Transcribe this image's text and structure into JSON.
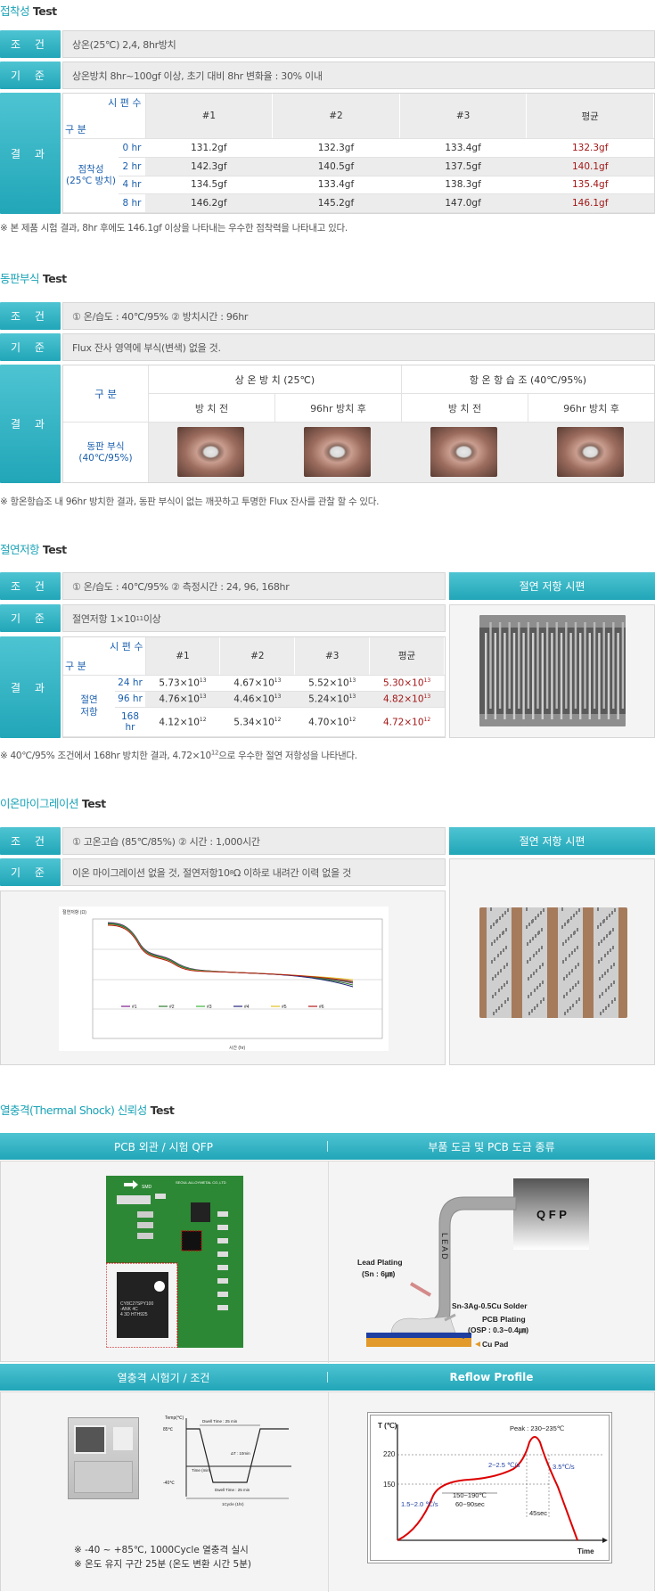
{
  "s1": {
    "title_k": "접착성",
    "title_t": " Test",
    "cond_label": "조 건",
    "cond_value": "상온(25℃) 2,4, 8hr방치",
    "std_label": "기 준",
    "std_value": "상온방치 8hr~100gf 이상, 초기 대비 8hr 변화율 : 30% 이내",
    "res_label": "결 과",
    "hdr_gubun": "구 분",
    "hdr_sample": "시 편 수",
    "hdr_cols": [
      "#1",
      "#2",
      "#3",
      "평균"
    ],
    "row_group": "점착성\n(25℃ 방치)",
    "rows": [
      {
        "t": "0 hr",
        "v": [
          "131.2gf",
          "132.3gf",
          "133.4gf",
          "132.3gf"
        ]
      },
      {
        "t": "2 hr",
        "v": [
          "142.3gf",
          "140.5gf",
          "137.5gf",
          "140.1gf"
        ]
      },
      {
        "t": "4 hr",
        "v": [
          "134.5gf",
          "133.4gf",
          "138.3gf",
          "135.4gf"
        ]
      },
      {
        "t": "8 hr",
        "v": [
          "146.2gf",
          "145.2gf",
          "147.0gf",
          "146.1gf"
        ]
      }
    ],
    "note": "※ 본 제품 시험 결과, 8hr 후에도 146.1gf 이상을 나타내는 우수한 점착력을 나타내고 있다."
  },
  "s2": {
    "title_k": "동판부식",
    "title_t": " Test",
    "cond_label": "조 건",
    "cond_value": "① 온/습도 : 40℃/95%     ② 방치시간 : 96hr",
    "std_label": "기 준",
    "std_value": "Flux 잔사 영역에 부식(변색) 없을 것.",
    "res_label": "결 과",
    "gubun": "구 분",
    "grp1": "상 온 방 치 (25℃)",
    "grp2": "항 온 항 습 조 (40℃/95%)",
    "sub": [
      "방 치 전",
      "96hr 방치 후",
      "방 치 전",
      "96hr 방치 후"
    ],
    "row_label": "동판 부식\n(40℃/95%)",
    "note": "※ 항온항습조 내 96hr 방치한 결과, 동판 부식이 없는 깨끗하고 투명한 Flux 잔사를 관찰 할 수 있다."
  },
  "s3": {
    "title_k": "절연저항",
    "title_t": " Test",
    "cond_label": "조 건",
    "cond_value": "① 온/습도 : 40℃/95%     ② 측정시간 :  24, 96, 168hr",
    "std_label": "기 준",
    "std_value_a": "절연저항 1×10",
    "std_value_sup": "11",
    "std_value_b": " 이상",
    "res_label": "결 과",
    "side_title": "절연 저항 시편",
    "hdr_gubun": "구 분",
    "hdr_sample": "시 편 수",
    "hdr_cols": [
      "#1",
      "#2",
      "#3",
      "평균"
    ],
    "row_group": "절연\n저항",
    "rows": [
      {
        "t": "24 hr",
        "v": [
          [
            "5.73×10",
            "13"
          ],
          [
            "4.67×10",
            "13"
          ],
          [
            "5.52×10",
            "13"
          ],
          [
            "5.30×10",
            "13"
          ]
        ]
      },
      {
        "t": "96 hr",
        "v": [
          [
            "4.76×10",
            "13"
          ],
          [
            "4.46×10",
            "13"
          ],
          [
            "5.24×10",
            "13"
          ],
          [
            "4.82×10",
            "13"
          ]
        ]
      },
      {
        "t": "168 hr",
        "v": [
          [
            "4.12×10",
            "12"
          ],
          [
            "5.34×10",
            "12"
          ],
          [
            "4.70×10",
            "12"
          ],
          [
            "4.72×10",
            "12"
          ]
        ]
      }
    ],
    "note_a": "※ 40℃/95% 조건에서 168hr 방치한 결과, 4.72×10",
    "note_sup": "12",
    "note_b": "으로 우수한 절연 저항성을 나타낸다."
  },
  "s4": {
    "title_k": "이온마이그레이션",
    "title_t": " Test",
    "cond_label": "조 건",
    "cond_value": "① 고온고습 (85℃/85%)     ② 시간 :  1,000시간",
    "std_label": "기 준",
    "std_value_a": "이온 마이그레이션 없을 것, 절연저항10",
    "std_value_sup": "8",
    "std_value_b": " Ω 이하로 내려간 이력 없을 것",
    "side_title": "절연 저항 시편",
    "chart_ylabel": "절연저항 (Ω)",
    "chart_xlabel": "시간 (hr)",
    "legend": [
      "#1",
      "#2",
      "#3",
      "#4",
      "#5",
      "#6"
    ],
    "legend_colors": [
      "#7a1a8c",
      "#2a7a2a",
      "#3ab53a",
      "#23237a",
      "#e0c020",
      "#b01a1a"
    ]
  },
  "s5": {
    "title_k": "열충격(Thermal Shock) 신뢰성",
    "title_t": "  Test",
    "hdr1": "PCB 외관 / 시험 QFP",
    "hdr2": "부품 도금 및  PCB 도금 종류",
    "hdr3": "열충격 시험기 / 조건",
    "hdr4": "Reflow Profile",
    "pcb_logo": "SEOUL ALLOYMETAL CO.,LTD",
    "pcb_smd": "SMD",
    "chip_text": "CY8C27SPY100\n-ANK 4C\n4 3D HTH925",
    "qfp": "Q F P",
    "lead": "L E A D",
    "lead_plating": "Lead Plating",
    "lead_plating2": "(Sn : 6㎛)",
    "solder": "Sn-3Ag-0.5Cu Solder",
    "pcb_plating": "PCB Plating",
    "pcb_plating2": "(OSP : 0.3~0.4㎛)",
    "cu_pad": "Cu Pad",
    "ts_temp": "Temp(℃)",
    "ts_85": "85℃",
    "ts_m40": "-40℃",
    "ts_dwell1": "Dwell Time : 25 min",
    "ts_dt": "ΔT : 10min",
    "ts_time": "Time (min)",
    "ts_dwell2": "Dwell Time : 25 min",
    "ts_cycle": "1Cycle (1hr)",
    "ts_note1": "※ -40 ~ +85℃, 1000Cycle 열충격 실시",
    "ts_note2": "※ 온도 유지 구간 25분 (온도 변환 시간 5분)",
    "rf_t": "T (℃)",
    "rf_220": "220",
    "rf_150": "150",
    "rf_peak": "Peak : 230~235℃",
    "rf_up": "2~2.5 ℃/s",
    "rf_down": "3.5℃/s",
    "rf_pre": "1.5~2.0 ℃/s",
    "rf_soak": "150~190℃",
    "rf_soak2": "60~90sec",
    "rf_45": "45sec",
    "rf_time": "Time"
  }
}
